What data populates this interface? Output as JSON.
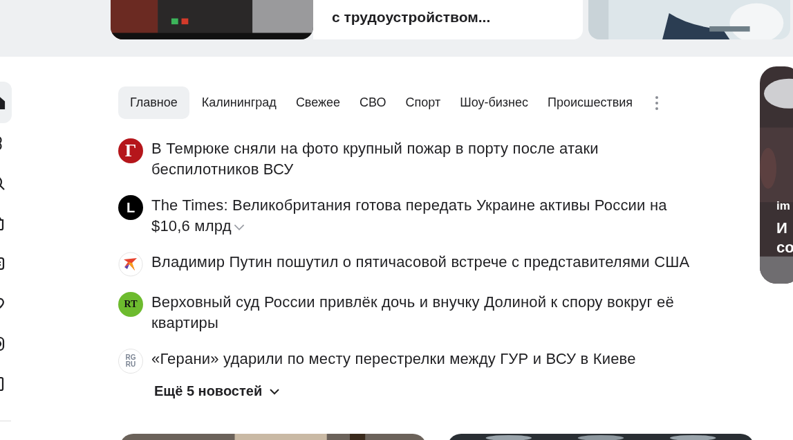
{
  "top_cards": [
    {
      "kind": "picture"
    },
    {
      "kind": "text",
      "title": "с трудоустройством..."
    },
    {
      "kind": "picture"
    }
  ],
  "sidebar": {
    "items": [
      {
        "selected": true
      },
      {
        "selected": false
      },
      {
        "selected": false
      },
      {
        "selected": false
      },
      {
        "selected": false
      },
      {
        "selected": false
      },
      {
        "selected": false
      },
      {
        "selected": false
      }
    ]
  },
  "tabs": [
    {
      "label": "Главное",
      "selected": true
    },
    {
      "label": "Калининград",
      "selected": false
    },
    {
      "label": "Свежее",
      "selected": false
    },
    {
      "label": "СВО",
      "selected": false
    },
    {
      "label": "Спорт",
      "selected": false
    },
    {
      "label": "Шоу-бизнес",
      "selected": false
    },
    {
      "label": "Происшествия",
      "selected": false
    }
  ],
  "news": [
    {
      "logo_text": "Г",
      "headline": "В Темрюке сняли на фото крупный пожар в порту после атаки беспилотников ВСУ",
      "expandable": false
    },
    {
      "logo_text": "L",
      "headline": "The Times: Великобритания готова передать Украине активы России на $10,6 млрд",
      "expandable": true
    },
    {
      "headline": "Владимир Путин пошутил о пятичасовой встрече с представителями США",
      "expandable": false
    },
    {
      "logo_text": "RT",
      "headline": "Верховный суд России привлёк дочь и внучку Долиной к спору вокруг её квартиры",
      "expandable": false
    },
    {
      "logo_text": "RG RU",
      "headline": "«Герани» ударили по месту перестрелки между ГУР и ВСУ в Киеве",
      "expandable": false
    }
  ],
  "more_button": "Ещё 5 новостей",
  "side_card": {
    "source": "im",
    "title_lines": [
      "И",
      "со"
    ]
  },
  "bottom_cards": [
    {
      "kind": "picture"
    },
    {
      "kind": "picture"
    }
  ]
}
